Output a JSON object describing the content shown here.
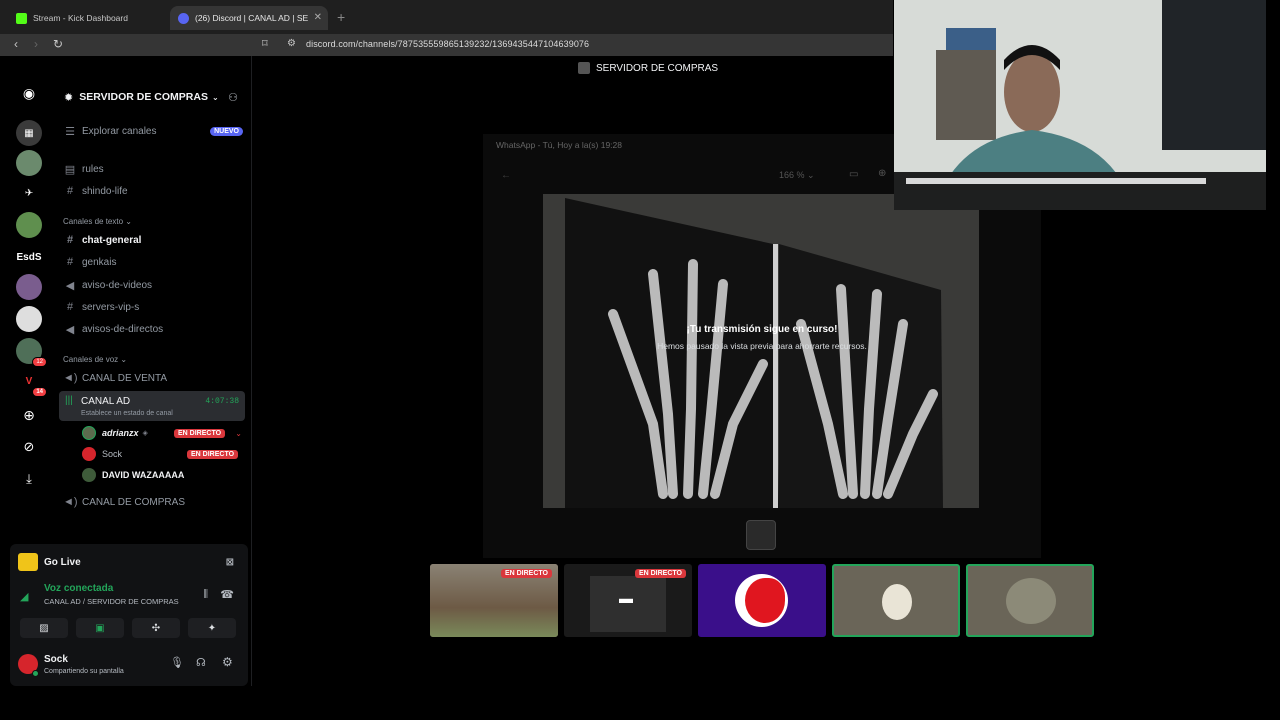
{
  "browser": {
    "tabs": [
      {
        "label": "Stream - Kick Dashboard"
      },
      {
        "label": "(26) Discord | CANAL AD | SE"
      }
    ],
    "new_tab": "+",
    "url": "discord.com/channels/787535559865139232/1369435447104639076"
  },
  "server": {
    "name": "SERVIDOR DE COMPRAS",
    "explore_label": "Explorar canales",
    "explore_badge": "NUEVO",
    "channels_top": [
      "rules",
      "shindo-life"
    ],
    "text_category": "Canales de texto",
    "text_channels": [
      "chat-general",
      "genkais",
      "aviso-de-videos",
      "servers-vip-s",
      "avisos-de-directos"
    ],
    "voice_category": "Canales de voz",
    "voice_channels": {
      "venta": "CANAL DE VENTA",
      "ad": "CANAL AD",
      "ad_timer": "4:07:38",
      "ad_status": "Establece un estado de canal",
      "compras": "CANAL DE COMPRAS"
    },
    "voice_users": [
      {
        "name": "adrianzx",
        "live": "EN DIRECTO"
      },
      {
        "name": "Sock",
        "live": "EN DIRECTO"
      },
      {
        "name": "DAVID WAZAAAAA"
      }
    ],
    "server_label": "EsdS",
    "badges": [
      "12",
      "14"
    ]
  },
  "panel": {
    "go_live": "Go Live",
    "voice_connected": "Voz conectada",
    "voice_location": "CANAL AD / SERVIDOR DE COMPRAS",
    "user_name": "Sock",
    "user_status": "Compartiendo su pantalla"
  },
  "stage": {
    "top_title": "SERVIDOR DE COMPRAS",
    "window_title": "WhatsApp - Tú, Hoy a la(s) 19:28",
    "zoom": "166 %",
    "paused_title": "¡Tu transmisión sigue en curso!",
    "paused_subtitle": "Hemos pausado la vista previa para ahorrarte recursos."
  },
  "tiles": [
    {
      "live": "EN DIRECTO"
    },
    {
      "live": "EN DIRECTO"
    }
  ],
  "colors": {
    "accent_green": "#23a55a",
    "live_red": "#da373c",
    "blurple": "#5865f2"
  }
}
